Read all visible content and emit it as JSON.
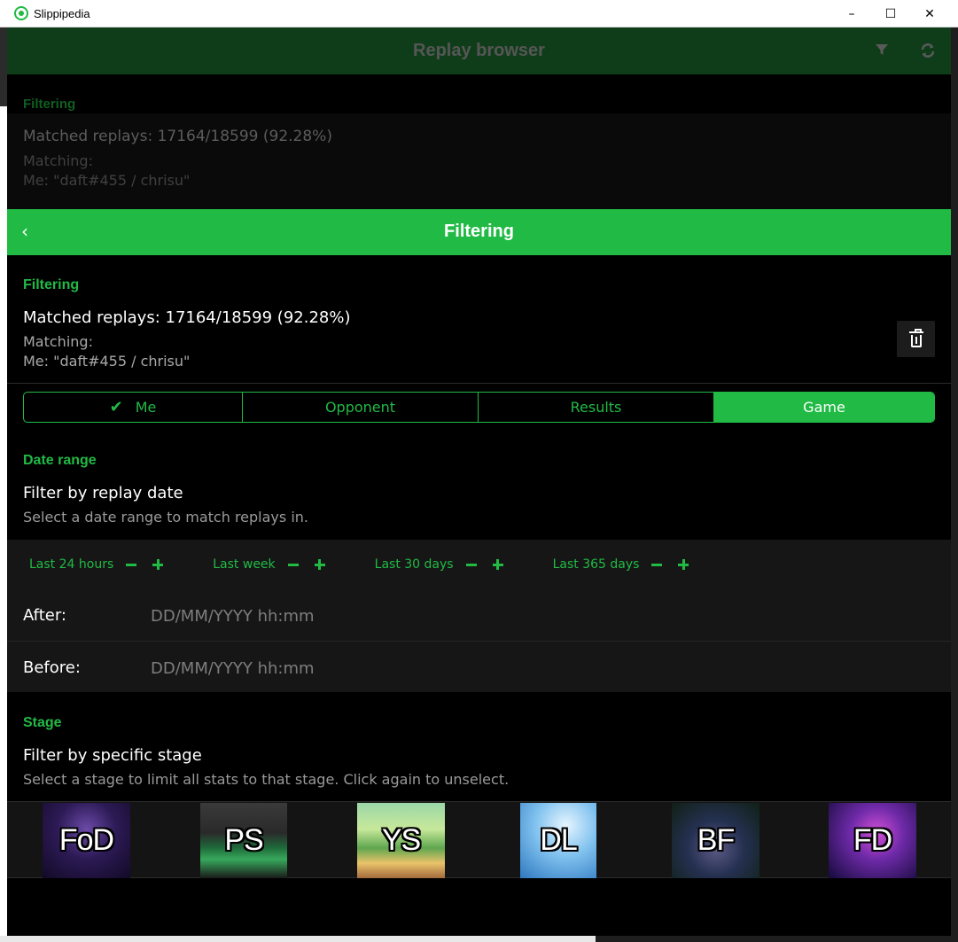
{
  "window": {
    "title": "Slippipedia",
    "minimize": "–",
    "maximize": "☐",
    "close": "✕"
  },
  "background_header": {
    "title": "Replay browser",
    "section_label": "Filtering",
    "matched": "Matched replays: 17164/18599 (92.28%)",
    "matching_label": "Matching:",
    "me_filter": "Me: \"daft#455 / chrisu\""
  },
  "header": {
    "back_label": "‹",
    "title": "Filtering"
  },
  "summary": {
    "section_label": "Filtering",
    "matched": "Matched replays: 17164/18599 (92.28%)",
    "matching_label": "Matching:",
    "me_filter": "Me: \"daft#455 / chrisu\""
  },
  "tabs": [
    {
      "label": "Me",
      "checked": true
    },
    {
      "label": "Opponent"
    },
    {
      "label": "Results"
    },
    {
      "label": "Game",
      "active": true
    }
  ],
  "date_range": {
    "section_label": "Date range",
    "title": "Filter by replay date",
    "description": "Select a date range to match replays in.",
    "quick_ranges": [
      "Last 24 hours",
      "Last week",
      "Last 30 days",
      "Last 365 days"
    ],
    "after_label": "After:",
    "before_label": "Before:",
    "after_placeholder": "DD/MM/YYYY hh:mm",
    "before_placeholder": "DD/MM/YYYY hh:mm"
  },
  "stage": {
    "section_label": "Stage",
    "title": "Filter by specific stage",
    "description": "Select a stage to limit all stats to that stage. Click again to unselect.",
    "stages": [
      "FoD",
      "PS",
      "YS",
      "DL",
      "BF",
      "FD"
    ]
  },
  "colors": {
    "accent": "#21ba45",
    "dim_header": "#0f3d19",
    "panel": "#161616"
  }
}
